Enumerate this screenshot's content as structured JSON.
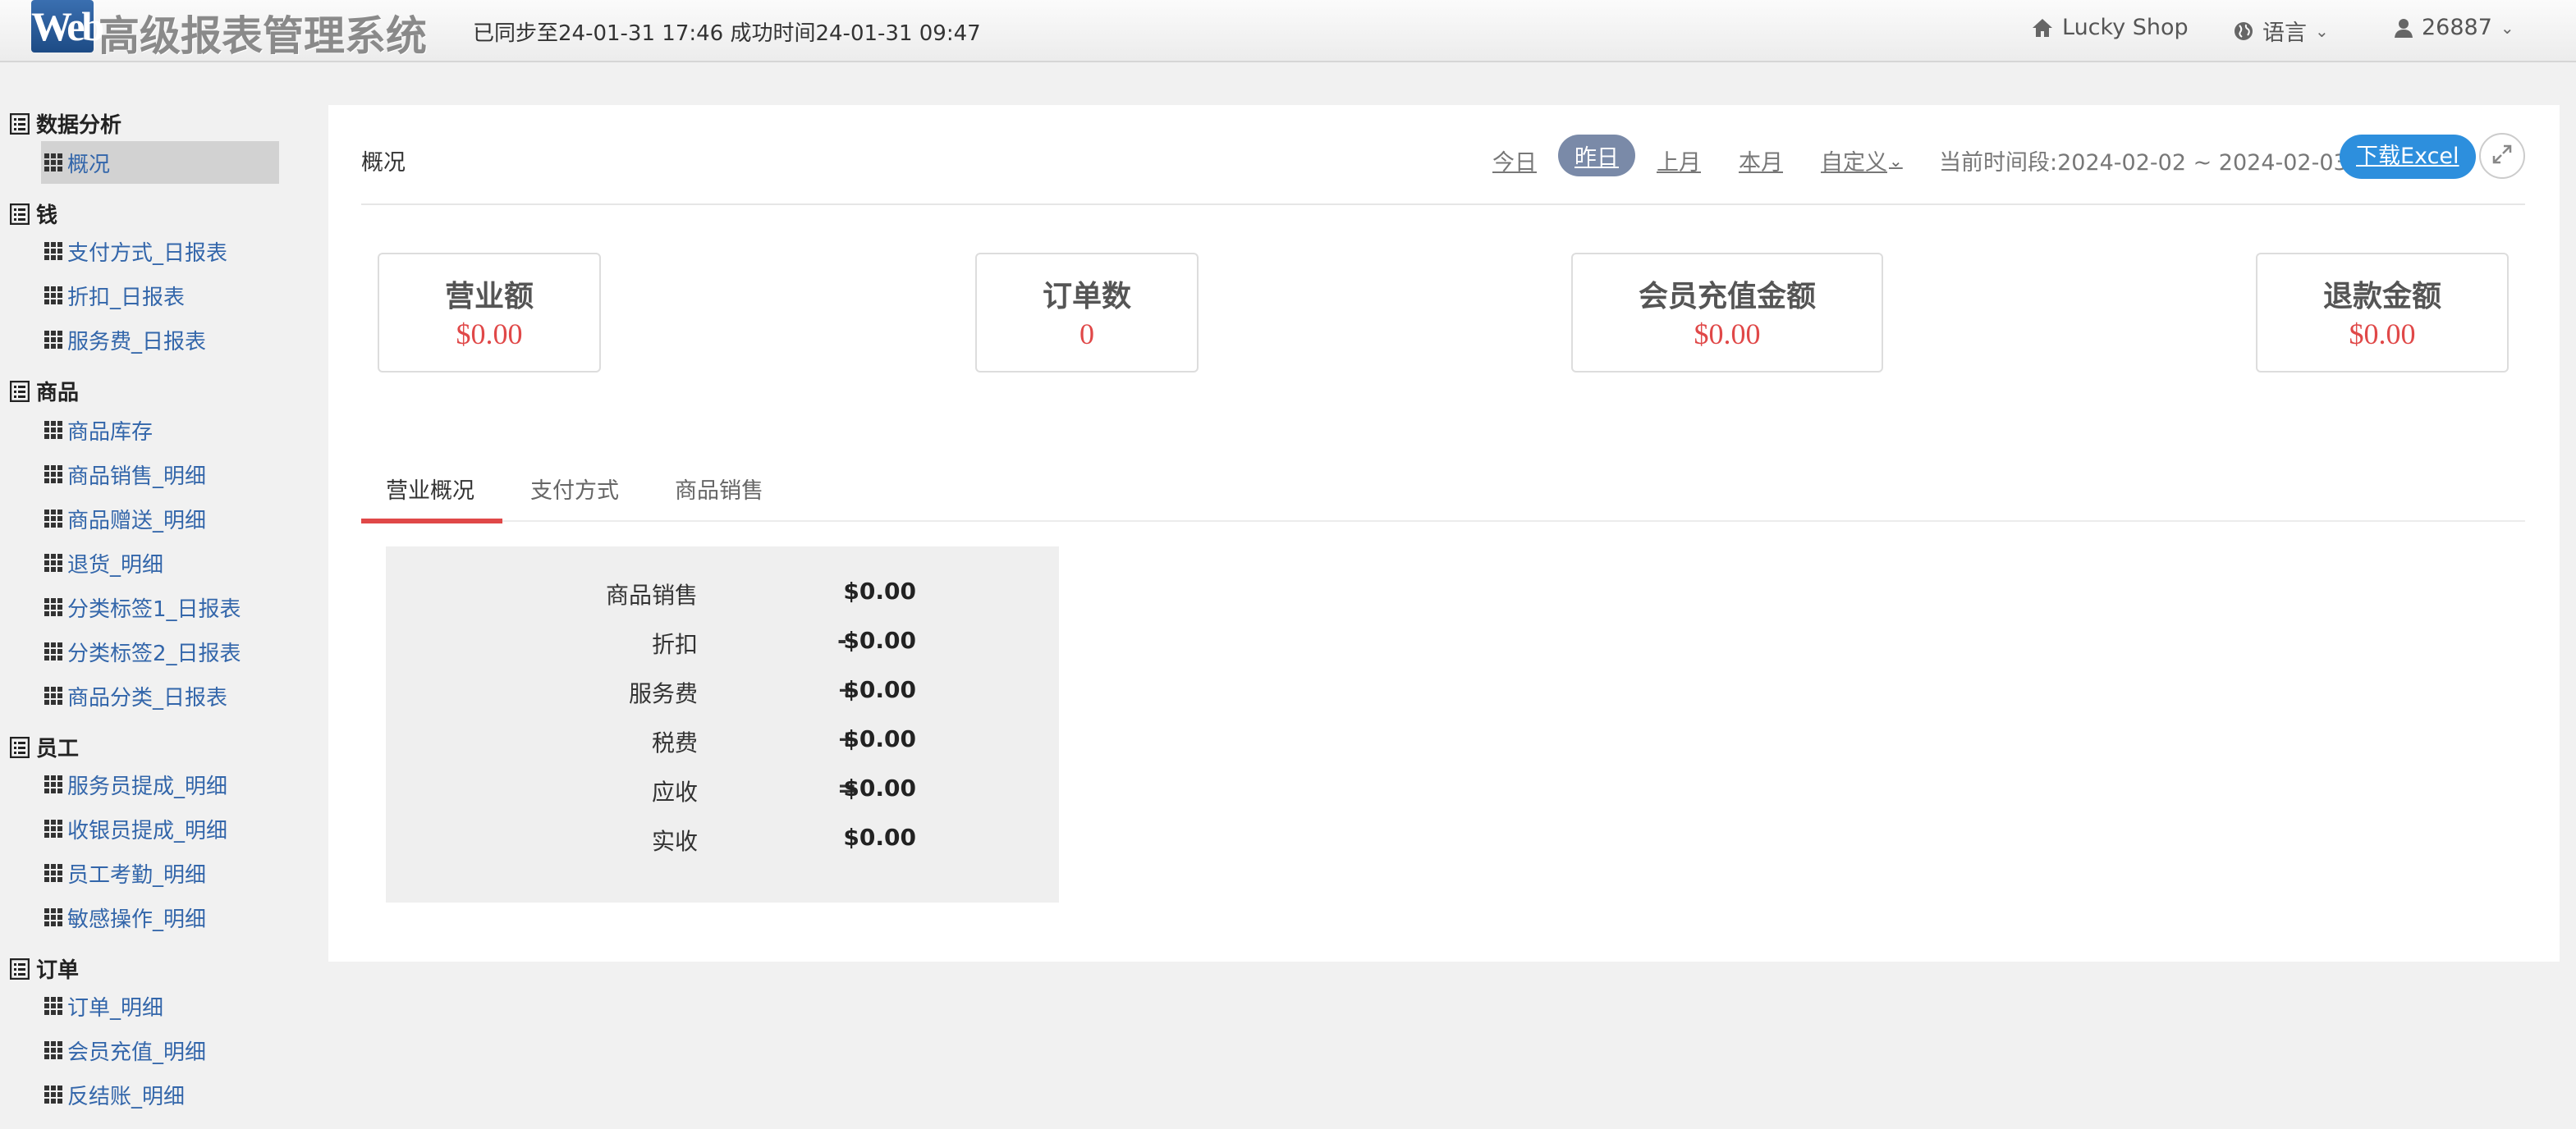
{
  "header": {
    "logo_mark": "Web",
    "app_title": "高级报表管理系统",
    "sync_status": "已同步至24-01-31 17:46 成功时间24-01-31 09:47",
    "shop_name": "Lucky Shop",
    "language_label": "语言",
    "user_id": "26887"
  },
  "sidebar": {
    "groups": [
      {
        "label": "数据分析",
        "items": [
          {
            "label": "概况"
          }
        ]
      },
      {
        "label": "钱",
        "items": [
          {
            "label": "支付方式_日报表"
          },
          {
            "label": "折扣_日报表"
          },
          {
            "label": "服务费_日报表"
          }
        ]
      },
      {
        "label": "商品",
        "items": [
          {
            "label": "商品库存"
          },
          {
            "label": "商品销售_明细"
          },
          {
            "label": "商品赠送_明细"
          },
          {
            "label": "退货_明细"
          },
          {
            "label": "分类标签1_日报表"
          },
          {
            "label": "分类标签2_日报表"
          },
          {
            "label": "商品分类_日报表"
          }
        ]
      },
      {
        "label": "员工",
        "items": [
          {
            "label": "服务员提成_明细"
          },
          {
            "label": "收银员提成_明细"
          },
          {
            "label": "员工考勤_明细"
          },
          {
            "label": "敏感操作_明细"
          }
        ]
      },
      {
        "label": "订单",
        "items": [
          {
            "label": "订单_明细"
          },
          {
            "label": "会员充值_明细"
          },
          {
            "label": "反结账_明细"
          }
        ]
      }
    ]
  },
  "main": {
    "title": "概况",
    "periods": [
      {
        "label": "今日"
      },
      {
        "label": "昨日"
      },
      {
        "label": "上月"
      },
      {
        "label": "本月"
      },
      {
        "label": "自定义"
      }
    ],
    "current_range": "当前时间段:2024-02-02 ~ 2024-02-03",
    "download_label": "下载Excel",
    "stats": [
      {
        "label": "营业额",
        "value": "$0.00"
      },
      {
        "label": "订单数",
        "value": "0"
      },
      {
        "label": "会员充值金额",
        "value": "$0.00"
      },
      {
        "label": "退款金额",
        "value": "$0.00"
      }
    ],
    "tabs": [
      {
        "label": "营业概况"
      },
      {
        "label": "支付方式"
      },
      {
        "label": "商品销售"
      }
    ],
    "summary": [
      {
        "label": "商品销售",
        "op": "",
        "value": "$0.00"
      },
      {
        "label": "折扣",
        "op": "-",
        "value": "$0.00"
      },
      {
        "label": "服务费",
        "op": "+",
        "value": "$0.00"
      },
      {
        "label": "税费",
        "op": "+",
        "value": "$0.00"
      },
      {
        "label": "应收",
        "op": "=",
        "value": "$0.00"
      },
      {
        "label": "实收",
        "op": "",
        "value": "$0.00"
      }
    ]
  },
  "colors": {
    "accent_red": "#e04848",
    "link_blue": "#3366aa",
    "button_blue": "#2d8fdd",
    "active_period": "#7a8aa8"
  }
}
